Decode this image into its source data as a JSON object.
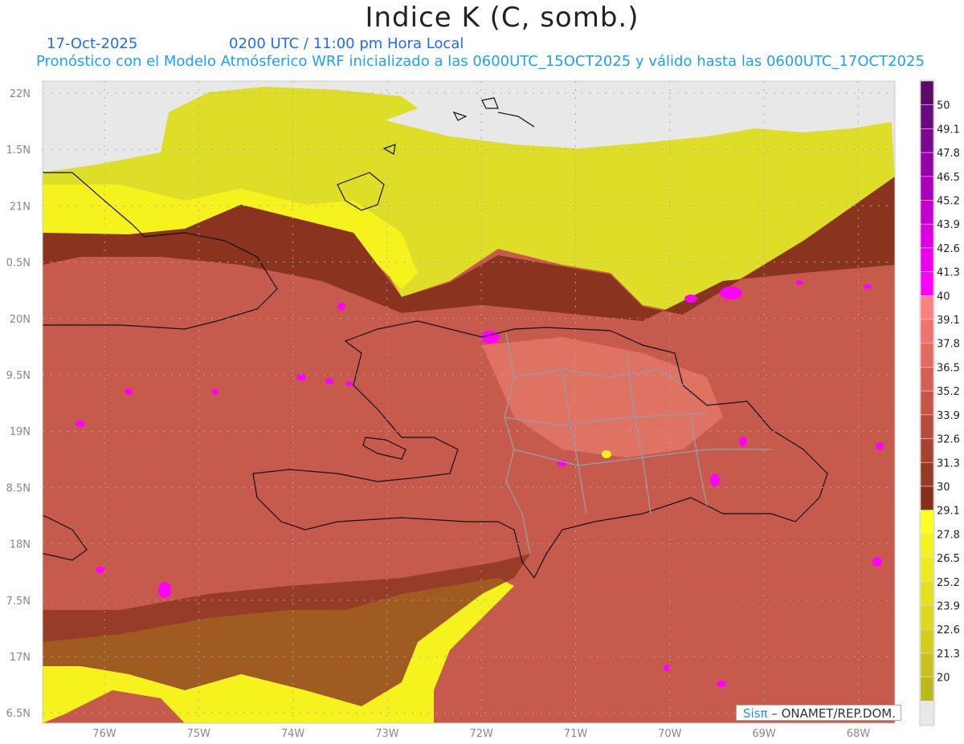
{
  "header": {
    "title": "Indice K (C, somb.)",
    "date": "17-Oct-2025",
    "time": "0200 UTC / 11:00 pm Hora Local",
    "description": "Pronóstico con el Modelo Atmósferico WRF inicializado a las 0600UTC_15OCT2025 y válido hasta las  0600UTC_17OCT2025"
  },
  "axes": {
    "lat_labels": [
      "22N",
      "1.5N",
      "21N",
      "0.5N",
      "20N",
      "9.5N",
      "19N",
      "8.5N",
      "18N",
      "7.5N",
      "17N",
      "6.5N"
    ],
    "lon_labels": [
      "76W",
      "75W",
      "74W",
      "73W",
      "72W",
      "71W",
      "70W",
      "69W",
      "68W"
    ]
  },
  "colorbar": {
    "labels": [
      "50",
      "49.1",
      "47.8",
      "46.5",
      "45.2",
      "43.9",
      "42.6",
      "41.3",
      "40",
      "39.1",
      "37.8",
      "36.5",
      "35.2",
      "33.9",
      "32.6",
      "31.3",
      "30",
      "29.1",
      "27.8",
      "26.5",
      "25.2",
      "23.9",
      "22.6",
      "21.3",
      "20"
    ],
    "colors": [
      "#5c0a68",
      "#6a0a7e",
      "#7a0890",
      "#9200a8",
      "#aa00bc",
      "#c400d0",
      "#dc00e0",
      "#ee00ee",
      "#ff00ff",
      "#ff8080",
      "#f07272",
      "#e46a60",
      "#d65e52",
      "#c65448",
      "#b64a3c",
      "#a64232",
      "#963a26",
      "#86301a",
      "#ffff20",
      "#f6f220",
      "#eeea20",
      "#e4e01e",
      "#dcd81c",
      "#d2ce1c",
      "#c8c41c",
      "#bcb81c",
      "#e8e8e8"
    ]
  },
  "watermark": {
    "brand": "Sisπ",
    "text": "– ONAMET/REP.DOM."
  }
}
